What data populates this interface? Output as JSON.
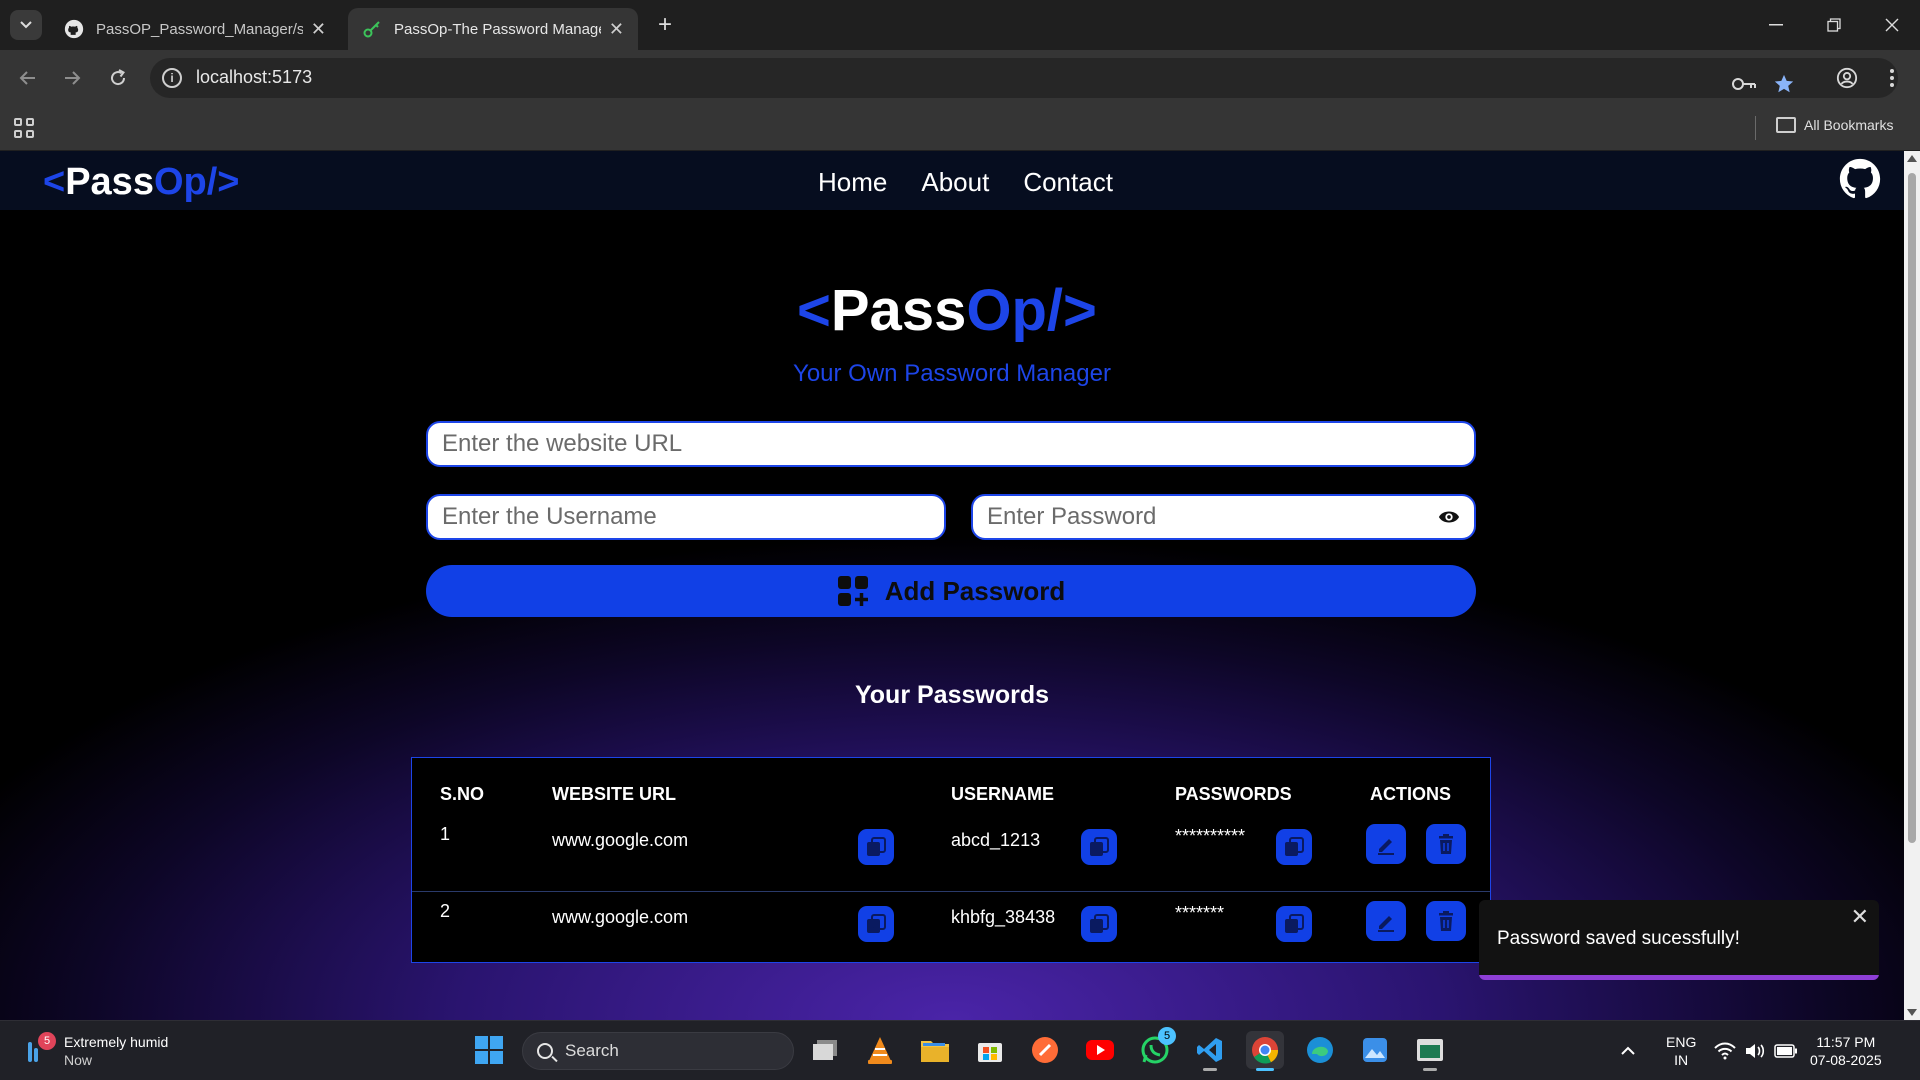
{
  "browser": {
    "tabs": [
      {
        "title": "PassOP_Password_Manager/src/",
        "active": false,
        "icon": "github-icon"
      },
      {
        "title": "PassOp-The Password Manager",
        "active": true,
        "icon": "key-icon"
      }
    ],
    "address": "localhost:5173",
    "bookmarks_label": "All Bookmarks"
  },
  "site": {
    "logo": {
      "open": "<",
      "pass": "Pass",
      "op": "Op/",
      "close": ">"
    },
    "nav_links": [
      "Home",
      "About",
      "Contact"
    ],
    "hero_logo": {
      "open": "<",
      "pass": "Pass",
      "op": "Op/",
      "close": ">"
    },
    "tagline": "Your Own Password Manager",
    "form": {
      "url_placeholder": "Enter the website URL",
      "username_placeholder": "Enter the Username",
      "password_placeholder": "Enter Password",
      "add_button": "Add Password"
    },
    "section_title": "Your Passwords",
    "table": {
      "headers": [
        "S.NO",
        "WEBSITE URL",
        "USERNAME",
        "PASSWORDS",
        "ACTIONS"
      ],
      "rows": [
        {
          "sno": "1",
          "url": "www.google.com",
          "username": "abcd_1213",
          "password": "**********"
        },
        {
          "sno": "2",
          "url": "www.google.com",
          "username": "khbfg_38438",
          "password": "*******"
        }
      ]
    },
    "toast": {
      "message": "Password saved sucessfully!",
      "close": "✕"
    }
  },
  "taskbar": {
    "weather": {
      "title": "Extremely humid",
      "sub": "Now",
      "badge": "5"
    },
    "search_label": "Search",
    "whatsapp_badge": "5",
    "lang": {
      "line1": "ENG",
      "line2": "IN"
    },
    "clock": {
      "time": "11:57 PM",
      "date": "07-08-2025"
    }
  },
  "colors": {
    "accent": "#1140e6",
    "logo_blue": "#1d45e8",
    "nav_bg": "#060d1f",
    "toast_bar": "#8e3fd6"
  }
}
